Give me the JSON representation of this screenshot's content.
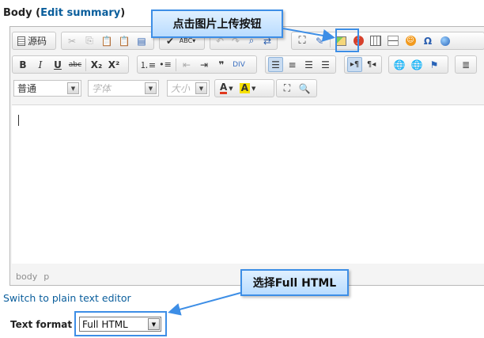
{
  "field_label": "Body",
  "field_label_open": "(",
  "field_label_link": "Edit summary",
  "field_label_close": ")",
  "toolbar": {
    "source_label": "源码",
    "format_value": "普通",
    "font_placeholder": "字体",
    "size_placeholder": "大小",
    "bold": "B",
    "italic": "I",
    "underline": "U",
    "strike": "abc",
    "subscript": "X₂",
    "superscript": "X²",
    "text_color": "A",
    "bg_color": "A"
  },
  "status_path": [
    "body",
    "p"
  ],
  "switch_link": "Switch to plain text editor",
  "text_format_label": "Text format",
  "text_format_value": "Full HTML",
  "callouts": {
    "upload": "点击图片上传按钮",
    "select": "选择Full HTML"
  },
  "colors": {
    "link": "#0a5e9c",
    "callout_border": "#3d8ee6",
    "callout_fill": "#cfe7ff",
    "image_icon": "#e5a430",
    "flash_icon": "#d6402b",
    "text_color_icon": "#e03a1f",
    "bg_color_icon": "#f6e000"
  }
}
